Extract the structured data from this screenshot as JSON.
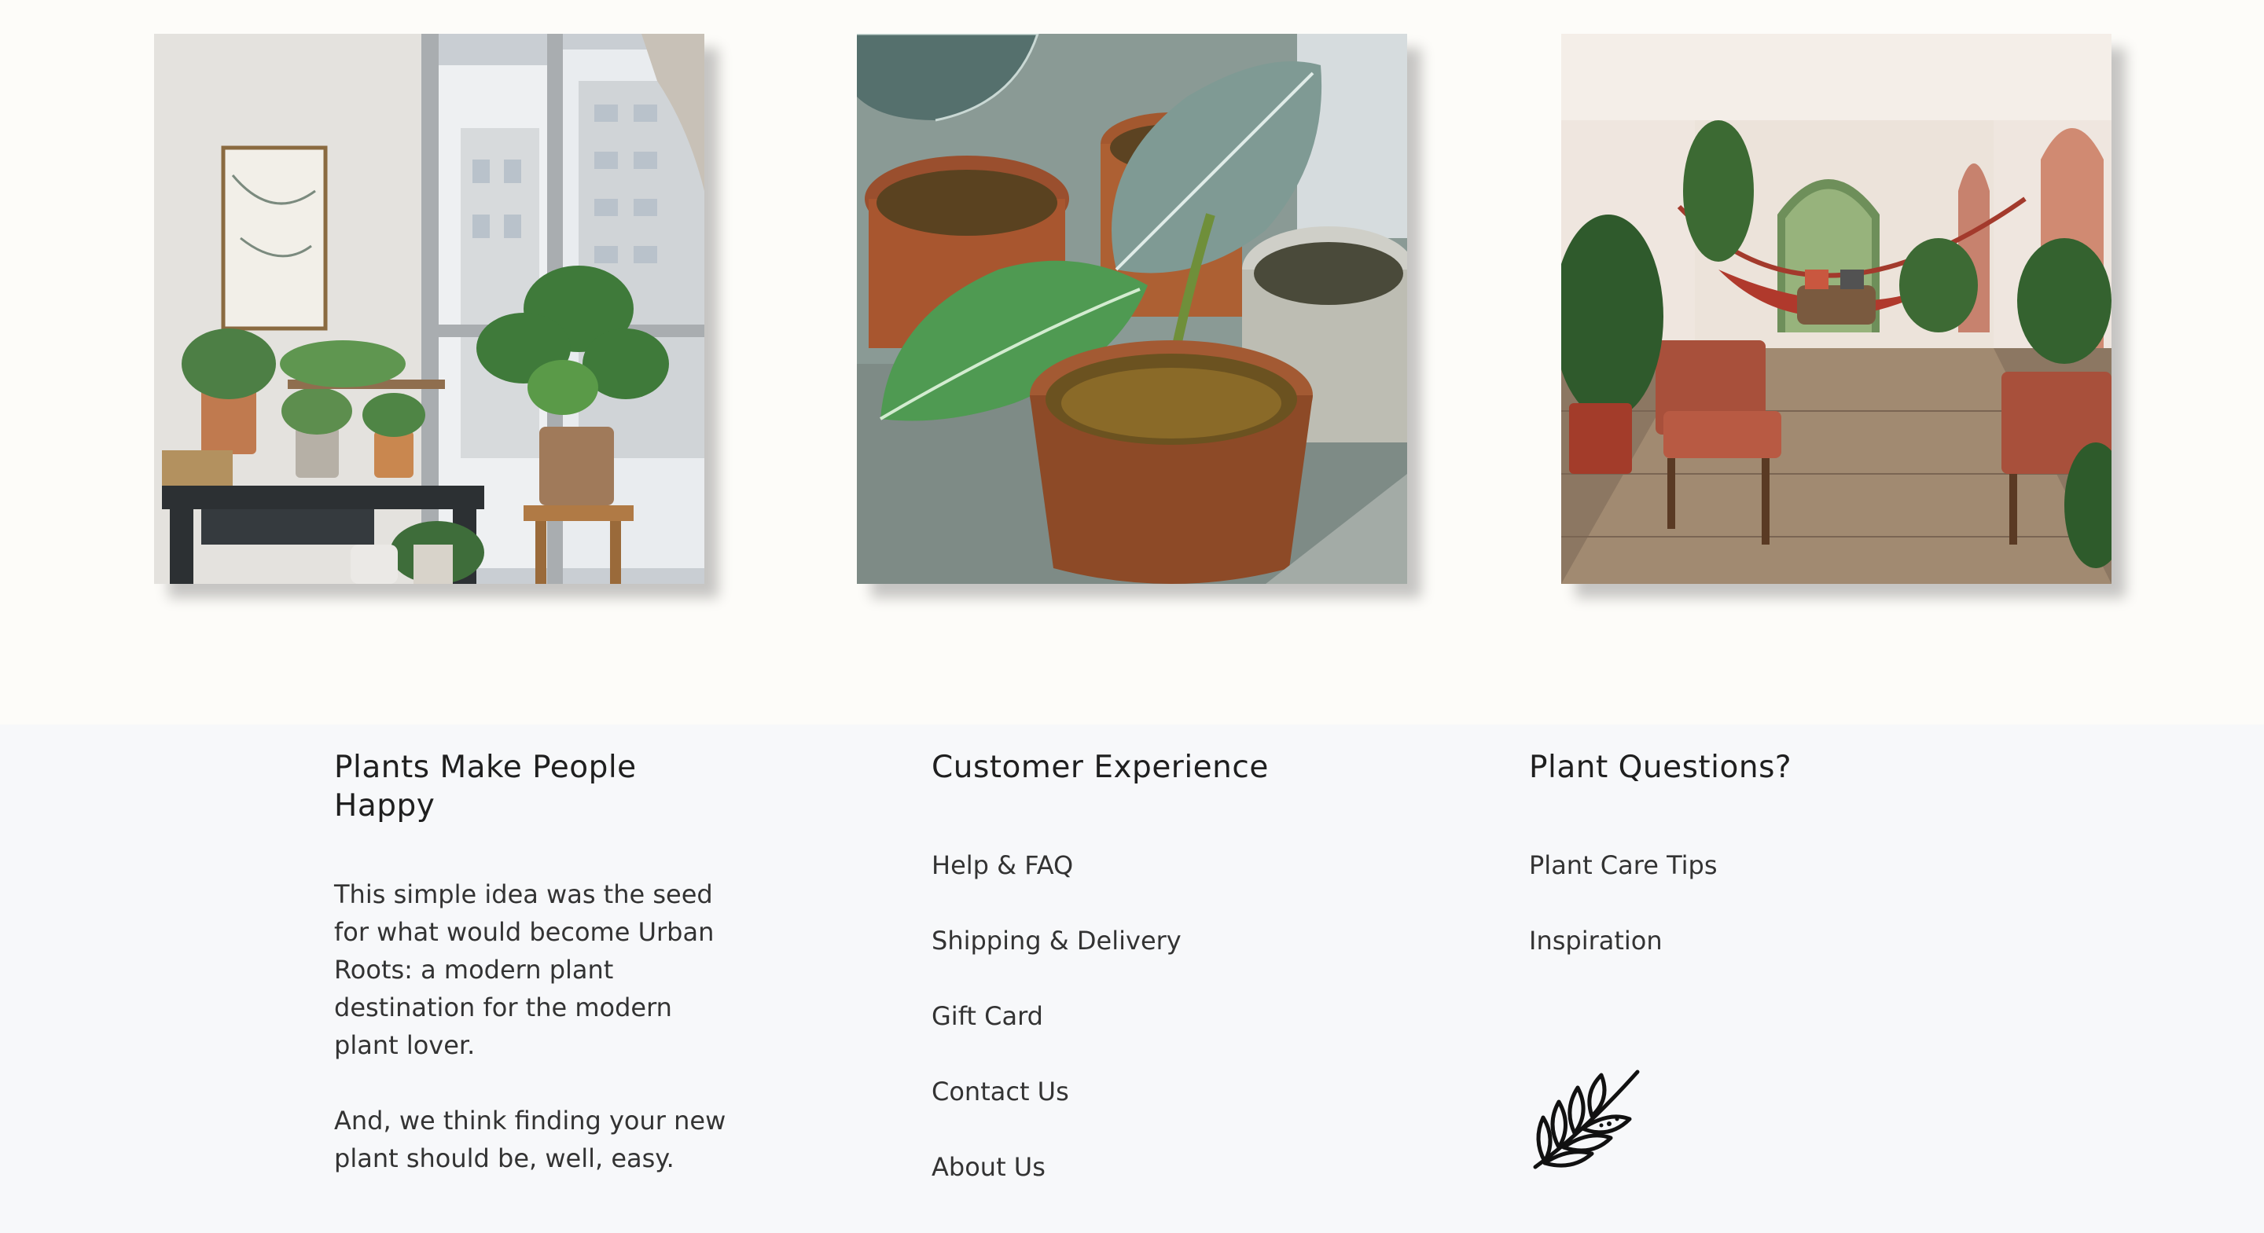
{
  "gallery": {
    "photos": [
      {
        "icon": "living-room-plant-shelf-photo"
      },
      {
        "icon": "potted-alocasia-photo"
      },
      {
        "icon": "hammock-room-photo"
      }
    ]
  },
  "footer": {
    "about": {
      "title": "Plants Make People Happy",
      "paragraph_1": "This simple idea was the seed for what would become Urban Roots: a modern plant destination for the modern plant lover.",
      "paragraph_2": "And, we think finding your new plant should be, well, easy."
    },
    "customer_experience": {
      "title": "Customer Experience",
      "links": [
        "Help & FAQ",
        "Shipping & Delivery",
        "Gift Card",
        "Contact Us",
        "About Us"
      ]
    },
    "plant_questions": {
      "title": "Plant Questions?",
      "links": [
        "Plant Care Tips",
        "Inspiration"
      ]
    },
    "logo_icon": "leaf-branch-icon"
  },
  "colors": {
    "page_background": "#fdfcf9",
    "footer_background": "#f7f8fa",
    "text": "#2b2b2b"
  }
}
